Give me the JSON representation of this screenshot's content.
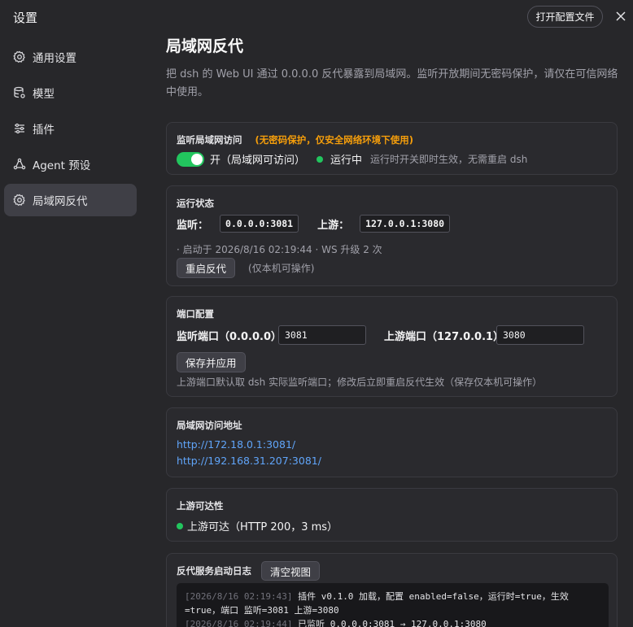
{
  "app": {
    "title": "设置"
  },
  "sidebar": {
    "items": [
      {
        "label": "通用设置",
        "icon": "gear-icon"
      },
      {
        "label": "模型",
        "icon": "model-icon"
      },
      {
        "label": "插件",
        "icon": "sliders-icon"
      },
      {
        "label": "Agent 预设",
        "icon": "agent-icon"
      },
      {
        "label": "局域网反代",
        "icon": "gear-icon",
        "active": true
      }
    ]
  },
  "header": {
    "open_config_label": "打开配置文件"
  },
  "page": {
    "title": "局域网反代",
    "description": "把 dsh 的 Web UI 通过 0.0.0.0 反代暴露到局域网。监听开放期间无密码保护，请仅在可信网络中使用。"
  },
  "lan_access": {
    "title": "监听局域网访问",
    "warning": "(无密码保护，仅安全网络环境下使用)",
    "toggle_label": "开（局域网可访问）",
    "toggle_on": true,
    "status_label": "运行中",
    "hint": "运行时开关即时生效，无需重启 dsh"
  },
  "runtime": {
    "title": "运行状态",
    "listen_label": "监听：",
    "listen_value": "0.0.0.0:3081",
    "upstream_label": "上游：",
    "upstream_value": "127.0.0.1:3080",
    "started_text": "· 启动于 2026/8/16 02:19:44 · WS 升级 2 次",
    "restart_label": "重启反代",
    "restart_note": "(仅本机可操作)"
  },
  "ports": {
    "title": "端口配置",
    "listen_port_label": "监听端口（0.0.0.0）",
    "listen_port_value": "3081",
    "upstream_port_label": "上游端口（127.0.0.1）",
    "upstream_port_value": "3080",
    "save_label": "保存并应用",
    "note": "上游端口默认取 dsh 实际监听端口；修改后立即重启反代生效（保存仅本机可操作）"
  },
  "addresses": {
    "title": "局域网访问地址",
    "links": [
      "http://172.18.0.1:3081/",
      "http://192.168.31.207:3081/"
    ]
  },
  "reachability": {
    "title": "上游可达性",
    "status": "上游可达（HTTP 200，3 ms）"
  },
  "logs": {
    "title": "反代服务启动日志",
    "clear_label": "清空视图",
    "lines": [
      {
        "ts": "[2026/8/16 02:19:43]",
        "text": " 插件 v0.1.0 加载，配置 enabled=false，运行时=true，生效=true，端口 监听=3081 上游=3080"
      },
      {
        "ts": "[2026/8/16 02:19:44]",
        "text": " 已监听 0.0.0.0:3081 → 127.0.0.1:3080"
      }
    ]
  },
  "colors": {
    "accent_green": "#22c55e",
    "warning": "#f59e0b",
    "link": "#60a5fa"
  }
}
